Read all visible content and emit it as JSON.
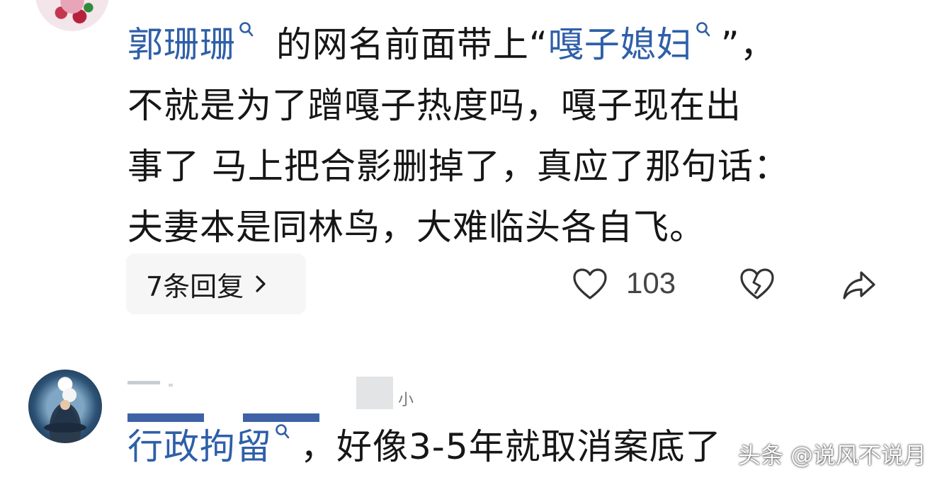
{
  "comment1": {
    "mention_user": "郭珊珊",
    "text_part1": " 的网名前面带上“",
    "mention_keyword": "嘎子媳妇",
    "text_part2": "”，",
    "line2": "不就是为了蹭嘎子热度吗，嘎子现在出",
    "line3": "事了 马上把合影删掉了，真应了那句话：",
    "line4": "夫妻本是同林鸟，大难临头各自飞。",
    "replies_label": "7条回复",
    "like_count": "103"
  },
  "comment2": {
    "mention_keyword": "行政拘留",
    "text": "，好像3-5年就取消案底了"
  },
  "watermark": "头条 @说风不说月",
  "colors": {
    "link": "#2f5fa8",
    "text": "#161616",
    "reply_bg": "#f6f6f7"
  },
  "icons": {
    "mention": "search-icon",
    "like": "heart-icon",
    "dislike": "broken-heart-icon",
    "share": "share-arrow-icon",
    "chevron": "chevron-right-icon"
  }
}
